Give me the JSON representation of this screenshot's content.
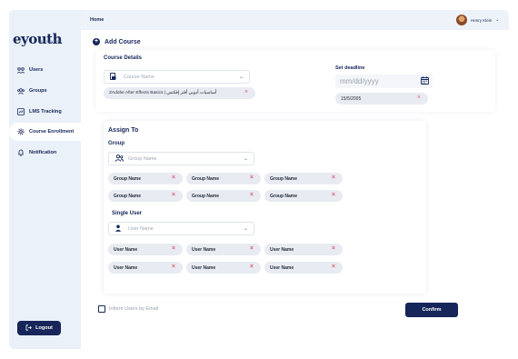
{
  "brand": {
    "logo": "eyouth",
    "logo_sub": "BUSINESS"
  },
  "sidebar": {
    "items": [
      {
        "label": "Users",
        "icon": "users-icon"
      },
      {
        "label": "Groups",
        "icon": "groups-icon"
      },
      {
        "label": "LMS Tracking",
        "icon": "tracking-icon"
      },
      {
        "label": "Course Enrollment",
        "icon": "gear-icon",
        "active": true
      },
      {
        "label": "Notification",
        "icon": "bell-icon"
      }
    ],
    "logout_label": "Logout"
  },
  "header": {
    "breadcrumb": "Home",
    "user_name": "Henry Klein"
  },
  "page": {
    "title": "Add Course"
  },
  "course_details": {
    "title": "Course Details",
    "course_placeholder": "Course Name",
    "selected_course": "ZAdobe After Effects Basics | أساسيات أدوبي أفتر إفكتس"
  },
  "deadline": {
    "title": "Set deadline",
    "placeholder": "mm/dd/yyyy",
    "selected_date": "15/5/2005"
  },
  "assign": {
    "title": "Assign To",
    "group_title": "Group",
    "group_placeholder": "Group  Name",
    "groups": [
      "Group Name",
      "Group Name",
      "Group Name",
      "Group Name",
      "Group Name",
      "Group Name"
    ],
    "single_user_title": "Single User",
    "user_placeholder": "User Name",
    "users": [
      "User Name",
      "User Name",
      "User Name",
      "User Name",
      "User Name",
      "User Name"
    ]
  },
  "footer": {
    "inform_label": "Inform Users by Email",
    "confirm_label": "Confirm"
  },
  "colors": {
    "primary": "#16265a",
    "remove": "#e0627a",
    "chip": "#e8ebf1"
  }
}
